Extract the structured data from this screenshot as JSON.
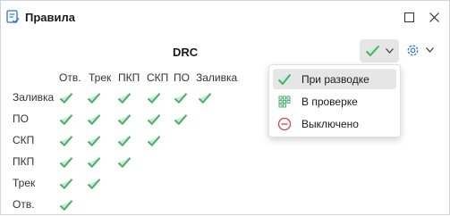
{
  "window": {
    "title": "Правила"
  },
  "section_title": "DRC",
  "columns": [
    "Отв.",
    "Трек",
    "ПКП",
    "СКП",
    "ПО",
    "Заливка"
  ],
  "rows": [
    {
      "label": "Заливка",
      "checks": 6
    },
    {
      "label": "ПО",
      "checks": 5
    },
    {
      "label": "СКП",
      "checks": 4
    },
    {
      "label": "ПКП",
      "checks": 3
    },
    {
      "label": "Трек",
      "checks": 2
    },
    {
      "label": "Отв.",
      "checks": 1
    }
  ],
  "status_menu": {
    "items": [
      {
        "label": "При разводке",
        "icon": "check-icon",
        "selected": true
      },
      {
        "label": "В проверке",
        "icon": "grid-dots-icon",
        "selected": false
      },
      {
        "label": "Выключено",
        "icon": "minus-circle-icon",
        "selected": false
      }
    ]
  },
  "colors": {
    "check": "#4caf6a",
    "disabled": "#d04848",
    "grid": "#4caf6a"
  }
}
